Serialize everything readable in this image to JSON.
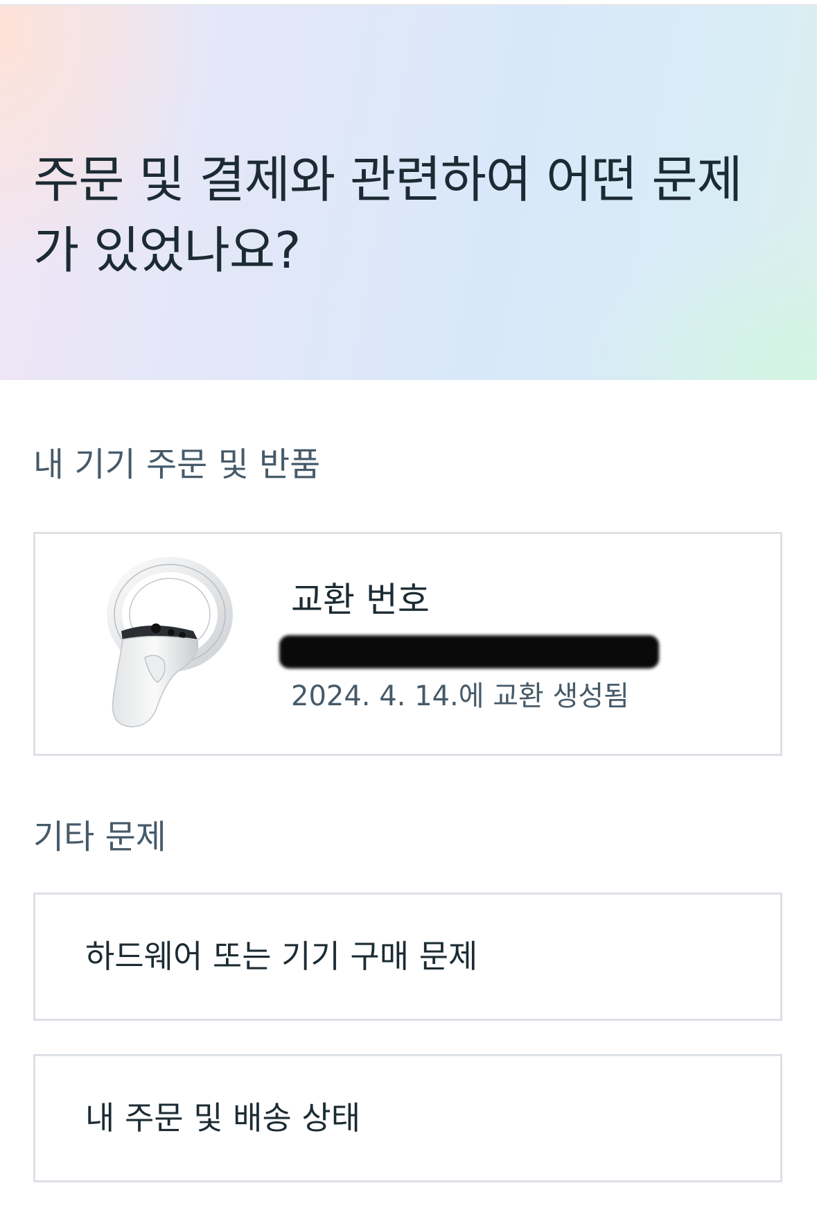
{
  "hero": {
    "title": "주문 및 결제와 관련하여 어떤 문제가 있었나요?"
  },
  "orders_section": {
    "label": "내 기기 주문 및 반품",
    "card": {
      "device_image": "vr-controller-image",
      "exchange_label": "교환 번호",
      "exchange_number": "",
      "exchange_number_redacted": true,
      "created_text": "2024. 4. 14.에 교환 생성됨"
    }
  },
  "other_section": {
    "label": "기타 문제",
    "items": [
      {
        "label": "하드웨어 또는 기기 구매 문제"
      },
      {
        "label": "내 주문 및 배송 상태"
      }
    ]
  },
  "colors": {
    "text_primary": "#1c2b33",
    "text_secondary": "#465a69",
    "card_border": "#dde1e6"
  }
}
